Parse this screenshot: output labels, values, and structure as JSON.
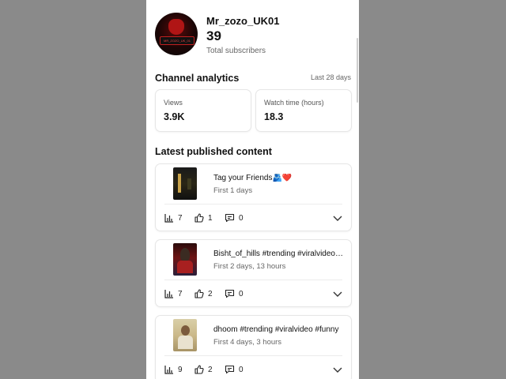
{
  "profile": {
    "channel_name": "Mr_zozo_UK01",
    "subscriber_count": "39",
    "subscriber_label": "Total subscribers",
    "avatar_text": "MR_ZOZO_UK_01"
  },
  "analytics": {
    "title": "Channel analytics",
    "period": "Last 28 days",
    "cards": [
      {
        "label": "Views",
        "value": "3.9K"
      },
      {
        "label": "Watch time (hours)",
        "value": "18.3"
      }
    ]
  },
  "latest": {
    "title": "Latest published content",
    "items": [
      {
        "title": "Tag your Friends🫂❤️",
        "subtitle": "First 1 days",
        "views": "7",
        "likes": "1",
        "comments": "0"
      },
      {
        "title": "Bisht_of_hills #trending #viralvideo …",
        "subtitle": "First 2 days, 13 hours",
        "views": "7",
        "likes": "2",
        "comments": "0"
      },
      {
        "title": "dhoom #trending #viralvideo #funny",
        "subtitle": "First 4 days, 3 hours",
        "views": "9",
        "likes": "2",
        "comments": "0"
      }
    ]
  },
  "icons": {
    "views": "bar-chart-icon",
    "likes": "thumbs-up-icon",
    "comments": "comment-icon",
    "expand": "chevron-down-icon"
  },
  "colors": {
    "backdrop": "#8a8a8a",
    "panel": "#ffffff",
    "text_primary": "#111111",
    "text_secondary": "#666666"
  }
}
